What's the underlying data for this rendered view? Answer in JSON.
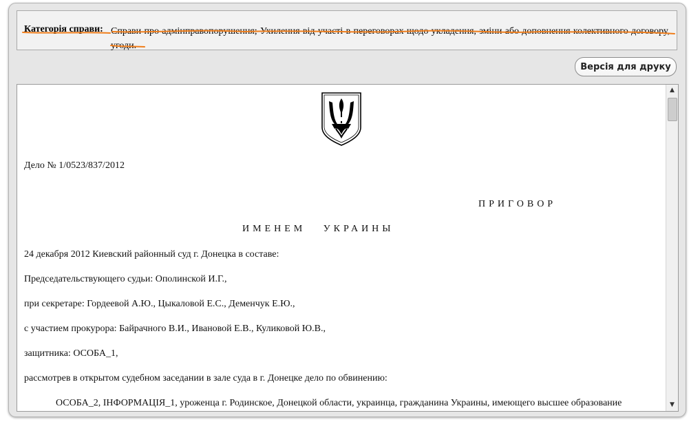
{
  "category": {
    "label": "Категорія справи:",
    "text": "Справи про адмінправопорушення; Ухилення від участі в переговорах щодо укладення, зміни або доповнення колективного договору, угоди."
  },
  "toolbar": {
    "print_label": "Версія для друку"
  },
  "document": {
    "case_number": "Дело № 1/0523/837/2012",
    "title": "ПРИГОВОР",
    "in_the_name": "ИМЕНЕМ   УКРАИНЫ",
    "lines": [
      "24 декабря 2012 Киевский районный суд г. Донецка в составе:",
      "Председательствующего судьи: Ополинской И.Г.,",
      "при секретаре: Гордеевой А.Ю., Цыкаловой Е.С., Деменчук Е.Ю.,",
      "с участием прокурора: Байрачного В.И., Ивановой Е.В., Куликовой Ю.В.,",
      "защитника: ОСОБА_1,",
      "рассмотрев в открытом судебном заседании в зале суда в г. Донецке дело по обвинению:"
    ],
    "paragraph": "ОСОБА_2, ІНФОРМАЦІЯ_1, уроженца г. Родинское, Донецкой области, украинца, гражданина Украины, имеющего высшее образование"
  },
  "colors": {
    "annotation": "#f07e1b",
    "frame_bg": "#e6e6e6"
  },
  "icons": {
    "emblem": "coat-of-arms-icon",
    "scroll_up": "arrow-up-icon",
    "scroll_down": "arrow-down-icon"
  }
}
